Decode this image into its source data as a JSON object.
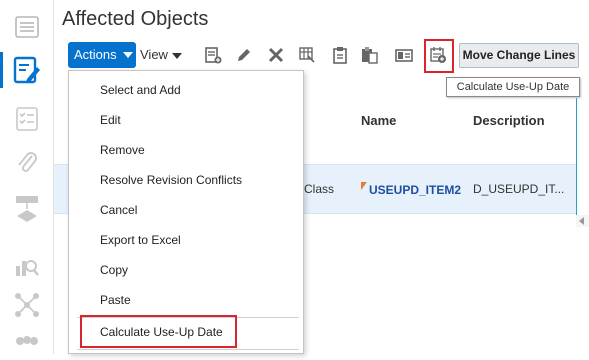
{
  "page": {
    "title": "Affected Objects"
  },
  "rail": {
    "icons": [
      "list-icon",
      "edit-document-icon",
      "checklist-icon",
      "paperclip-icon",
      "workflow-icon",
      "chart-search-icon",
      "network-icon",
      "people-icon"
    ]
  },
  "toolbar": {
    "actions_label": "Actions",
    "view_label": "View",
    "move_change_lines_label": "Move Change Lines",
    "icons": [
      "add-row-icon",
      "pencil-icon",
      "delete-x-icon",
      "table-icon",
      "clipboard-icon",
      "paste-icon",
      "export-icon",
      "calculate-use-up-date-icon"
    ]
  },
  "tooltip": {
    "text": "Calculate Use-Up Date"
  },
  "table": {
    "headers": [
      "Name",
      "Description"
    ],
    "row": {
      "class_text": "Class",
      "name": "USEUPD_ITEM2",
      "description": "D_USEUPD_IT..."
    }
  },
  "actions_menu": {
    "items": [
      "Select and Add",
      "Edit",
      "Remove",
      "Resolve Revision Conflicts",
      "Cancel",
      "Export to Excel",
      "Copy",
      "Paste",
      "Calculate Use-Up Date"
    ]
  },
  "colors": {
    "accent": "#0572ce",
    "highlight": "#d9262c",
    "selected_row": "#e6f1fb",
    "link": "#1f4fa0"
  }
}
